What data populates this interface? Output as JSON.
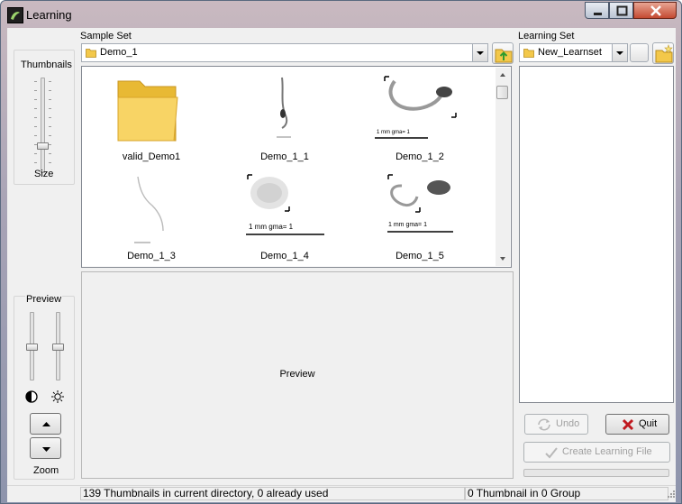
{
  "window": {
    "title": "Learning",
    "app_icon": "app-logo-icon",
    "caption_buttons": [
      "minimize-icon",
      "maximize-icon",
      "close-icon"
    ]
  },
  "left_panel": {
    "thumbnails_label": "Thumbnails",
    "size_label": "Size",
    "preview_label": "Preview",
    "contrast_icon": "contrast-icon",
    "brightness_icon": "brightness-icon",
    "zoom_label": "Zoom",
    "up_icon": "arrow-up-icon",
    "down_icon": "arrow-down-icon"
  },
  "sample_set": {
    "label": "Sample Set",
    "selected": "Demo_1",
    "open_icon": "folder-up-icon",
    "thumbnails": [
      {
        "name": "valid_Demo1",
        "kind": "folder"
      },
      {
        "name": "Demo_1_1",
        "kind": "image"
      },
      {
        "name": "Demo_1_2",
        "kind": "image",
        "scale_text": "1 mm    gma= 1"
      },
      {
        "name": "Demo_1_3",
        "kind": "image"
      },
      {
        "name": "Demo_1_4",
        "kind": "image",
        "scale_text": "1 mm    gma= 1"
      },
      {
        "name": "Demo_1_5",
        "kind": "image",
        "scale_text": "1 mm    gma= 1"
      }
    ]
  },
  "preview": {
    "label": "Preview"
  },
  "learning_set": {
    "label": "Learning Set",
    "selected": "New_Learnset",
    "new_icon": "new-folder-icon",
    "buttons": {
      "undo": "Undo",
      "quit": "Quit",
      "create": "Create Learning File"
    }
  },
  "status": {
    "left": "139 Thumbnails in current directory, 0 already used",
    "right": "0 Thumbnail in 0 Group"
  },
  "colors": {
    "accent_folder": "#f3c84a",
    "quit_x": "#c0191f",
    "window_frame": "#a9a4b6"
  }
}
